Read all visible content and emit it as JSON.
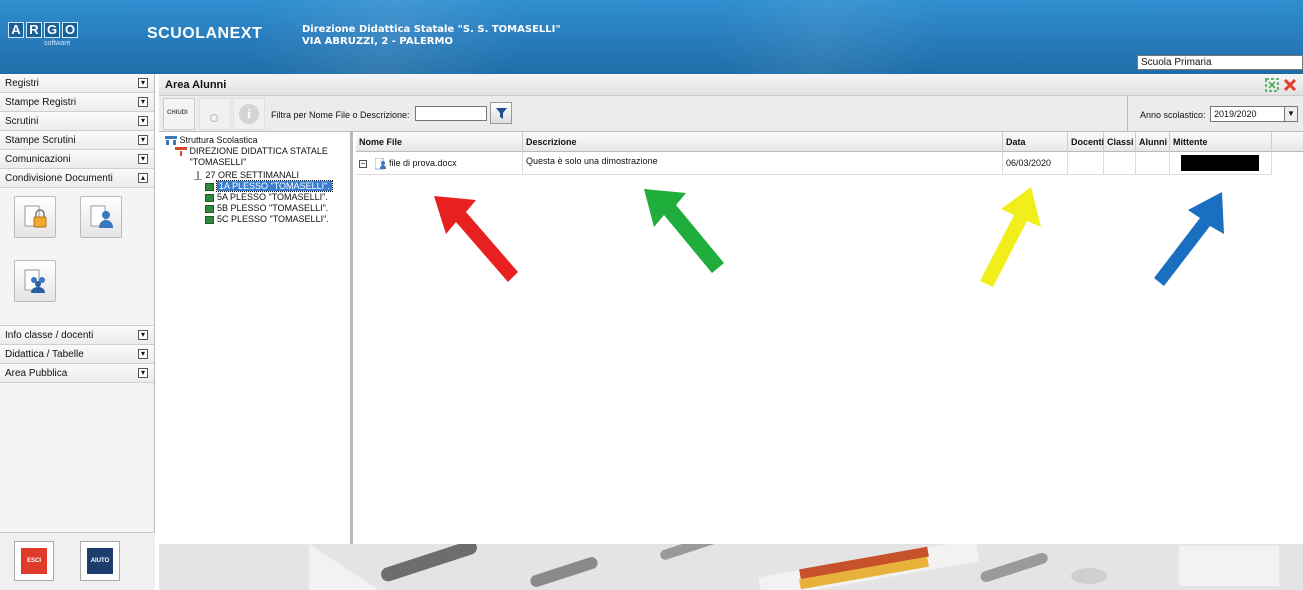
{
  "header": {
    "logo_letters": [
      "A",
      "R",
      "G",
      "O"
    ],
    "logo_sub": "software",
    "brand": "SCUOLANEXT",
    "school_name": "Direzione Didattica Statale \"S. S. TOMASELLI\"",
    "school_address": "VIA ABRUZZI, 2 - PALERMO",
    "school_level": "Scuola Primaria"
  },
  "sidebar": {
    "items_top": [
      {
        "label": "Registri"
      },
      {
        "label": "Stampe Registri"
      },
      {
        "label": "Scrutini"
      },
      {
        "label": "Stampe Scrutini"
      },
      {
        "label": "Comunicazioni"
      },
      {
        "label": "Condivisione Documenti"
      }
    ],
    "tiles": [
      "lock-doc-icon",
      "person-doc-icon",
      "people-doc-icon"
    ],
    "items_bottom": [
      {
        "label": "Info classe / docenti"
      },
      {
        "label": "Didattica / Tabelle"
      },
      {
        "label": "Area Pubblica"
      }
    ],
    "exit_label": "ESCI",
    "help_label": "AIUTO"
  },
  "main": {
    "title": "Area Alunni",
    "toolbar": {
      "close_label": "CHIUDI",
      "filter_label": "Filtra per Nome File o Descrizione:",
      "filter_value": "",
      "year_label": "Anno scolastico:",
      "year_value": "2019/2020"
    },
    "tree": {
      "root": "Struttura Scolastica",
      "school_line1": "DIREZIONE DIDATTICA STATALE",
      "school_line2": "\"TOMASELLI\"",
      "hours": "27 ORE SETTIMANALI",
      "classes": [
        "1A PLESSO \"TOMASELLI\".",
        "5A PLESSO \"TOMASELLI\".",
        "5B PLESSO \"TOMASELLI\".",
        "5C PLESSO \"TOMASELLI\"."
      ]
    },
    "grid": {
      "columns": [
        "Nome File",
        "Descrizione",
        "Data",
        "Docenti",
        "Classi",
        "Alunni",
        "Mittente"
      ],
      "rows": [
        {
          "file": "file di prova.docx",
          "descrizione": "Questa è solo una dimostrazione",
          "data": "06/03/2020",
          "docenti": "",
          "classi": "",
          "alunni": "",
          "mittente": ""
        }
      ]
    }
  },
  "colors": {
    "header_blue": "#2a7fbf",
    "arrow_red": "#e8201f",
    "arrow_green": "#1fae3c",
    "arrow_yellow": "#f2ee1c",
    "arrow_blue": "#1a6fc0"
  }
}
